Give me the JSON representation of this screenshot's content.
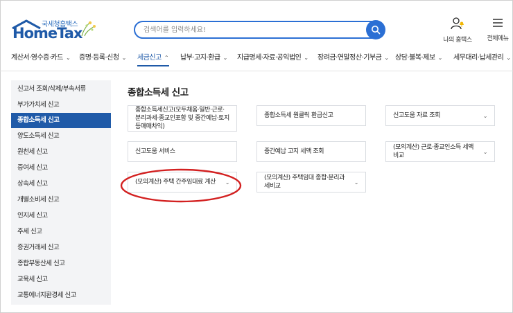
{
  "header": {
    "logo_sub": "국세청홈택스",
    "logo_main": "HomeTax",
    "search_placeholder": "검색어를 입력하세요!",
    "my_hometax": "나의 홈택스",
    "all_menu": "전체메뉴"
  },
  "gnb": {
    "items": [
      {
        "label": "계산서·영수증·카드"
      },
      {
        "label": "증명·등록·신청"
      },
      {
        "label": "세금신고"
      },
      {
        "label": "납부·고지·환급"
      },
      {
        "label": "지급명세·자료·공익법인"
      },
      {
        "label": "장려금·연말정산·기부금"
      },
      {
        "label": "상담·불복·제보"
      },
      {
        "label": "세무대리·납세관리"
      }
    ],
    "active_index": 2
  },
  "sidebar": {
    "items": [
      {
        "label": "신고서 조회/삭제/부속서류"
      },
      {
        "label": "부가가치세 신고"
      },
      {
        "label": "종합소득세 신고"
      },
      {
        "label": "양도소득세 신고"
      },
      {
        "label": "원천세 신고"
      },
      {
        "label": "증여세 신고"
      },
      {
        "label": "상속세 신고"
      },
      {
        "label": "개별소비세 신고"
      },
      {
        "label": "인지세 신고"
      },
      {
        "label": "주세 신고"
      },
      {
        "label": "증권거래세 신고"
      },
      {
        "label": "종합부동산세 신고"
      },
      {
        "label": "교육세 신고"
      },
      {
        "label": "교통에너지환경세 신고"
      }
    ],
    "active_index": 2
  },
  "main": {
    "title": "종합소득세 신고",
    "cards": [
      {
        "label": "종합소득세신고(모두채움·일반·근로·분리과세·종교인포함 및 중간예납·토지등매매차익)"
      },
      {
        "label": "종합소득세 원클릭 환급신고"
      },
      {
        "label": "신고도움 자료 조회"
      },
      {
        "label": "신고도움 서비스"
      },
      {
        "label": "중간예납 고지 세액 조회"
      },
      {
        "label": "(모의계산) 근로·종교인소득 세액비교"
      },
      {
        "label": "(모의계산) 주택 간주임대료 계산"
      },
      {
        "label": "(모의계산) 주택임대 종합·분리과세비교"
      }
    ]
  },
  "colors": {
    "accent": "#1f5aa8",
    "search_border": "#2b6fd4",
    "highlight_circle": "#d32020"
  },
  "icons": {
    "search": "search-icon",
    "my_hometax": "user-bell-icon",
    "all_menu": "hamburger-menu-icon",
    "chevron": "chevron-down-icon"
  }
}
